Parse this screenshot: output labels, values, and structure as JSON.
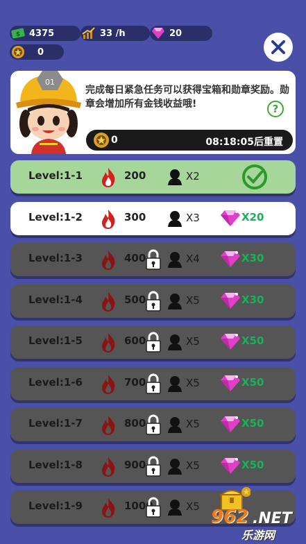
{
  "hud": {
    "cash": "4375",
    "income_rate": "33 /h",
    "gems": "20",
    "medals": "0"
  },
  "info": {
    "description": "完成每日紧急任务可以获得宝箱和勋章奖励。勋章会增加所有金钱收益哦!",
    "help_label": "?",
    "medal_count": "0",
    "reset_timer": "08:18:05后重置"
  },
  "levels": [
    {
      "label": "Level:1-1",
      "cost": "200",
      "multiplier": "X2",
      "state": "done",
      "reward": ""
    },
    {
      "label": "Level:1-2",
      "cost": "300",
      "multiplier": "X3",
      "state": "active",
      "reward": "X20"
    },
    {
      "label": "Level:1-3",
      "cost": "400",
      "multiplier": "X4",
      "state": "locked",
      "reward": "X30"
    },
    {
      "label": "Level:1-4",
      "cost": "500",
      "multiplier": "X5",
      "state": "locked",
      "reward": "X30"
    },
    {
      "label": "Level:1-5",
      "cost": "600",
      "multiplier": "X5",
      "state": "locked",
      "reward": "X50"
    },
    {
      "label": "Level:1-6",
      "cost": "700",
      "multiplier": "X5",
      "state": "locked",
      "reward": "X50"
    },
    {
      "label": "Level:1-7",
      "cost": "800",
      "multiplier": "X5",
      "state": "locked",
      "reward": "X50"
    },
    {
      "label": "Level:1-8",
      "cost": "900",
      "multiplier": "X5",
      "state": "locked",
      "reward": "X50"
    },
    {
      "label": "Level:1-9",
      "cost": "1000",
      "multiplier": "X5",
      "state": "locked",
      "reward": ""
    }
  ],
  "watermark": {
    "top": "962",
    "suffix": ".NET",
    "bottom": "乐游网"
  },
  "colors": {
    "background": "#4a4fa8",
    "done_row": "#a6d69a",
    "locked_row": "#555555",
    "reward_green": "#16b35a",
    "gem": "#e040c8",
    "flame": "#d21f1f"
  },
  "icons": [
    "cash-icon",
    "income-chart-icon",
    "gem-icon",
    "medal-icon",
    "close-icon",
    "help-icon",
    "flame-icon",
    "lock-icon",
    "person-icon",
    "check-icon",
    "chest-icon"
  ]
}
